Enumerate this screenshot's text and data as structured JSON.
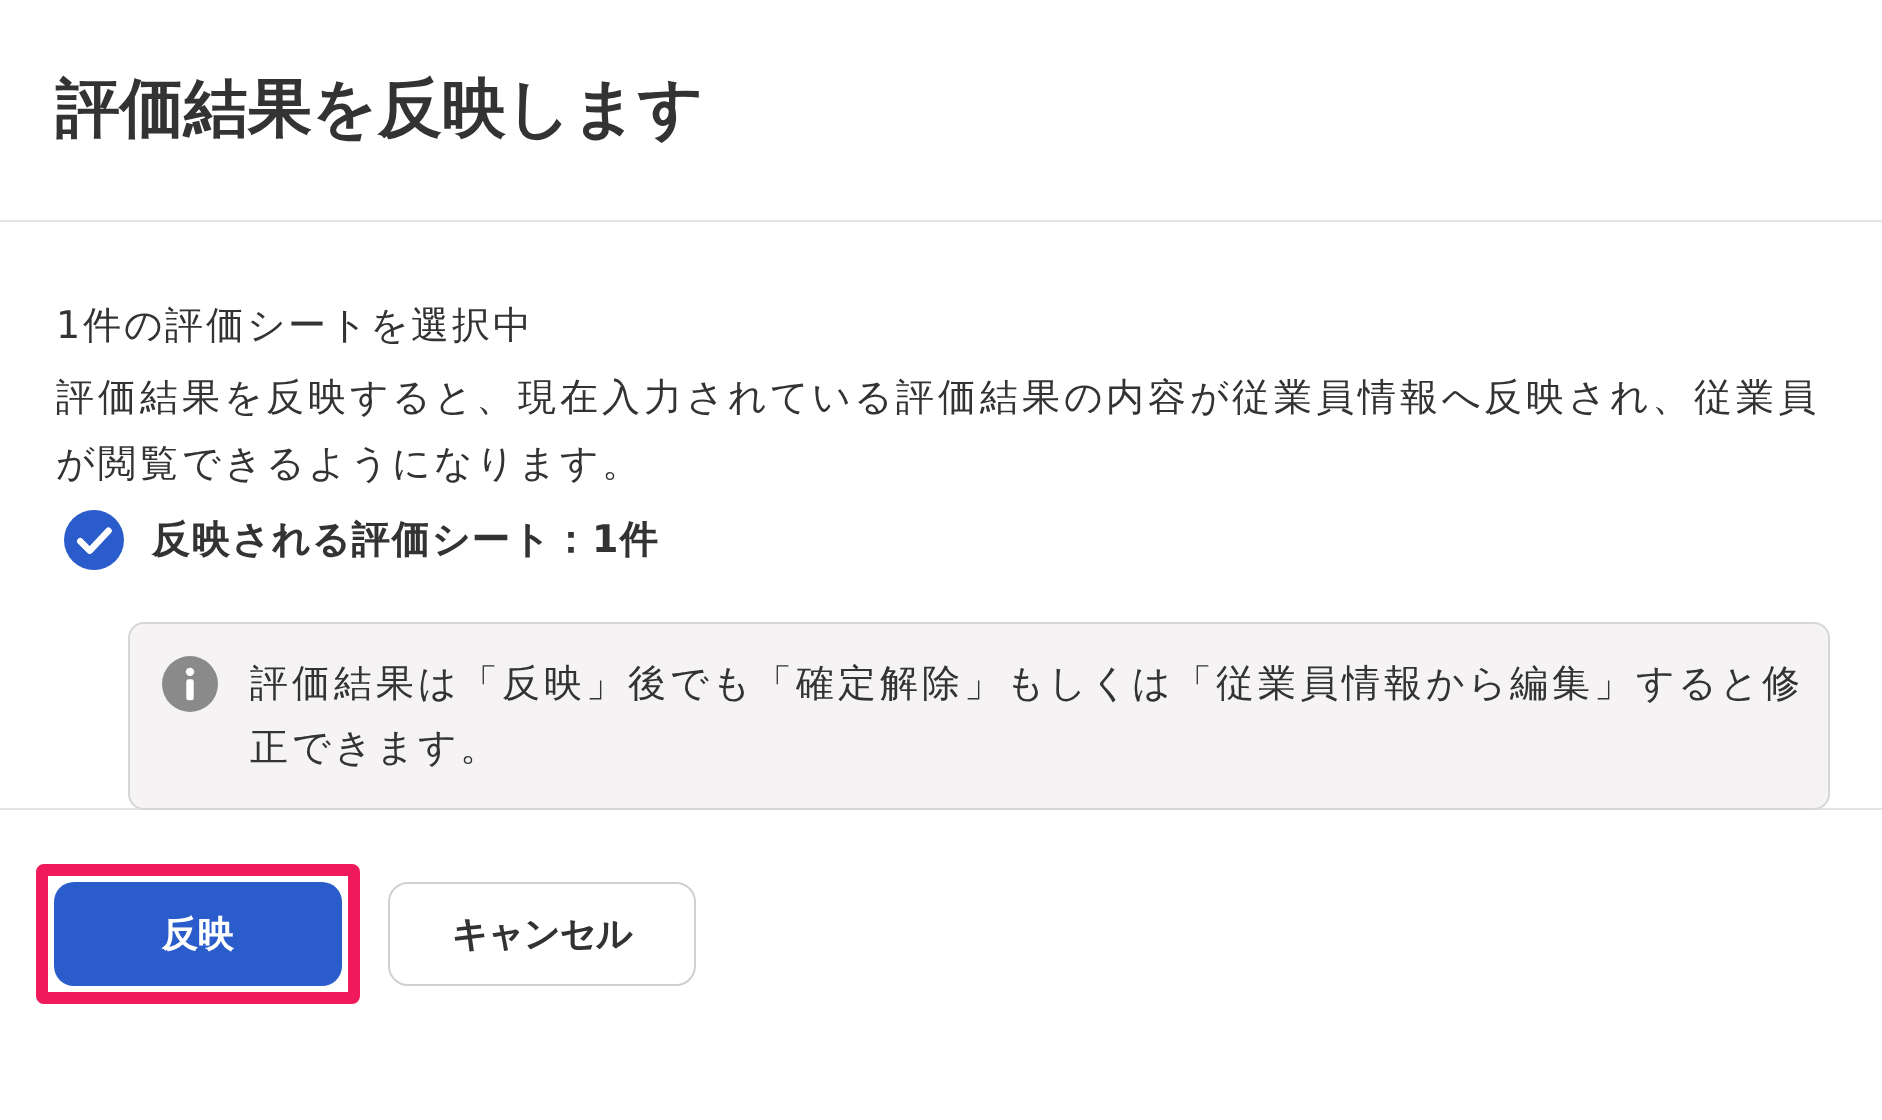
{
  "dialog": {
    "title": "評価結果を反映します",
    "selection_count": "1件の評価シートを選択中",
    "description": "評価結果を反映すると、現在入力されている評価結果の内容が従業員情報へ反映され、従業員が閲覧できるようになります。",
    "check_item": {
      "label": "反映される評価シート：1件",
      "checked": true
    },
    "notice": {
      "kind": "info",
      "text": "評価結果は「反映」後でも「確定解除」もしくは「従業員情報から編集」すると修正できます。"
    },
    "buttons": [
      {
        "label": "反映",
        "kind": "primary",
        "highlighted": true
      },
      {
        "label": "キャンセル",
        "kind": "secondary",
        "highlighted": false
      }
    ]
  }
}
